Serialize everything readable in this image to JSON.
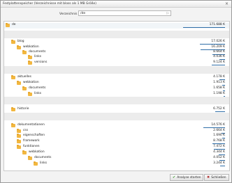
{
  "window": {
    "title": "Festplattenspeicher (Verzeichnisse mit bloss als 1 MB Größe)",
    "close_glyph": "×"
  },
  "path": {
    "label": "Verzeichnis",
    "value": "/de",
    "go_icon": "go-icon"
  },
  "rows": [
    {
      "name": "de",
      "size": "171.688 K",
      "level": 0,
      "bar": 1.0
    },
    {
      "name": "blog",
      "size": "17.026 K",
      "level": 1,
      "bar": 0.6
    },
    {
      "name": "webkation",
      "size": "16.209 K",
      "level": 2,
      "bar": 0.58
    },
    {
      "name": "documents",
      "size": "8.664 K",
      "level": 3,
      "bar": 0.3
    },
    {
      "name": "links",
      "size": "4.036 K",
      "level": 4,
      "bar": 0.14
    },
    {
      "name": "versions",
      "size": "9.124 K",
      "level": 4,
      "bar": 0.32
    },
    {
      "name": "aktuelles",
      "size": "4.178 K",
      "level": 1,
      "bar": 0.14
    },
    {
      "name": "webkation",
      "size": "1.913 K",
      "level": 2,
      "bar": 0.06
    },
    {
      "name": "documents",
      "size": "1.658 K",
      "level": 3,
      "bar": 0.05
    },
    {
      "name": "links",
      "size": "1.198 K",
      "level": 4,
      "bar": 0.04
    },
    {
      "name": "historie",
      "size": "6.752 K",
      "level": 1,
      "bar": 0.23
    },
    {
      "name": "dokumentationen",
      "size": "14.576 K",
      "level": 1,
      "bar": 0.52
    },
    {
      "name": "css",
      "size": "2.664 K",
      "level": 2,
      "bar": 0.09
    },
    {
      "name": "eigenschaften",
      "size": "1.690 K",
      "level": 2,
      "bar": 0.06
    },
    {
      "name": "framework",
      "size": "8.768 K",
      "level": 2,
      "bar": 0.3
    },
    {
      "name": "funktionen",
      "size": "7.472 K",
      "level": 2,
      "bar": 0.26
    },
    {
      "name": "webkation",
      "size": "4.344 K",
      "level": 3,
      "bar": 0.15
    },
    {
      "name": "documents",
      "size": "4.052 K",
      "level": 4,
      "bar": 0.14
    },
    {
      "name": "links",
      "size": "3.244 K",
      "level": 5,
      "bar": 0.11
    }
  ],
  "footer": {
    "start_label": "Analyse starten",
    "close_label": "Schließen",
    "start_icon": "check-icon",
    "close_icon": "close-icon"
  }
}
